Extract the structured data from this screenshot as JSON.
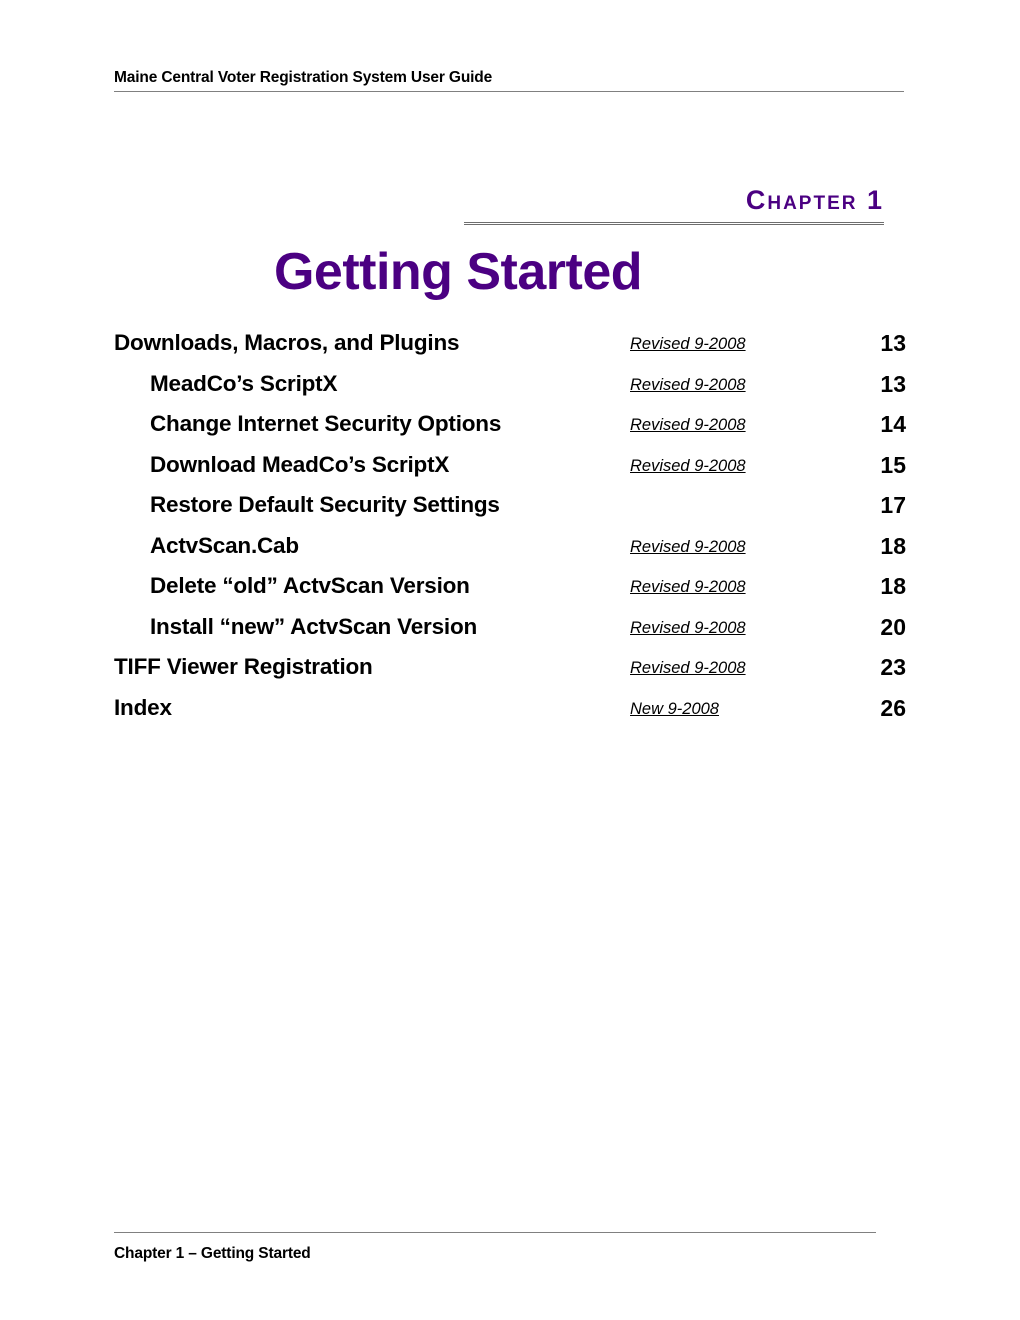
{
  "header": {
    "title": "Maine Central Voter Registration System User Guide"
  },
  "chapter": {
    "label": "Chapter 1",
    "title": "Getting Started",
    "accent_color": "#4B0082"
  },
  "toc": {
    "entries": [
      {
        "title": "Downloads, Macros, and Plugins",
        "note": "Revised 9-2008",
        "page": "13",
        "level": 0
      },
      {
        "title": "MeadCo’s ScriptX",
        "note": "Revised 9-2008",
        "page": "13",
        "level": 1
      },
      {
        "title": "Change Internet Security Options",
        "note": "Revised 9-2008",
        "page": "14",
        "level": 1
      },
      {
        "title": "Download MeadCo’s ScriptX",
        "note": "Revised 9-2008",
        "page": "15",
        "level": 1
      },
      {
        "title": "Restore Default Security Settings",
        "note": "",
        "page": "17",
        "level": 1
      },
      {
        "title": "ActvScan.Cab",
        "note": "Revised 9-2008",
        "page": "18",
        "level": 1
      },
      {
        "title": "Delete “old” ActvScan Version",
        "note": "Revised 9-2008",
        "page": "18",
        "level": 1
      },
      {
        "title": "Install “new” ActvScan Version",
        "note": "Revised 9-2008",
        "page": "20",
        "level": 1
      },
      {
        "title": "TIFF Viewer Registration",
        "note": "Revised 9-2008",
        "page": "23",
        "level": 0
      },
      {
        "title": "Index",
        "note": "New 9-2008",
        "page": "26",
        "level": 0
      }
    ]
  },
  "footer": {
    "text": "Chapter 1 – Getting Started"
  }
}
